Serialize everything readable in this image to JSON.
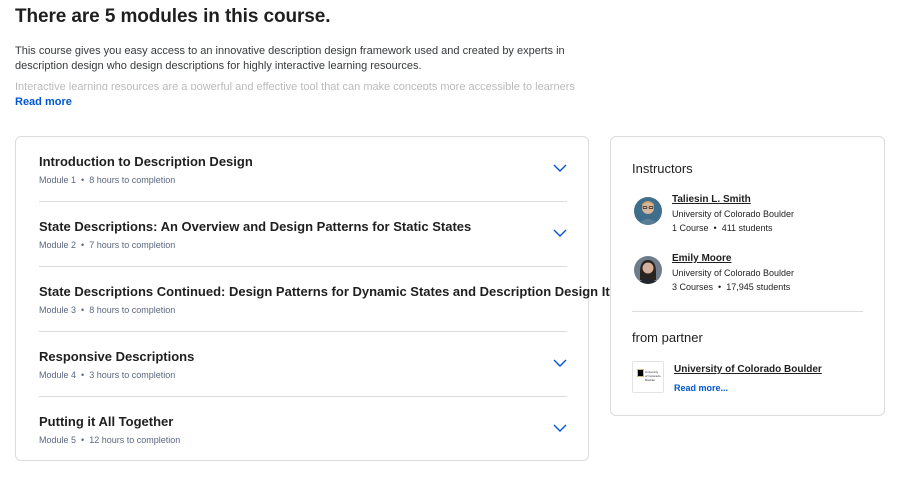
{
  "page": {
    "title": "There are 5 modules in this course.",
    "description": "This course gives you easy access to an innovative description design framework used and created by experts in description design who design descriptions for highly interactive learning resources.",
    "description_fade": "Interactive learning resources are a powerful and effective tool that can make concepts more accessible to learners everywhere.",
    "read_more": "Read more"
  },
  "modules": [
    {
      "title": "Introduction to Description Design",
      "label": "Module 1",
      "duration": "8 hours to completion",
      "expandable": true
    },
    {
      "title": "State Descriptions: An Overview and Design Patterns for Static States",
      "label": "Module 2",
      "duration": "7 hours to completion",
      "expandable": true
    },
    {
      "title": "State Descriptions Continued: Design Patterns for Dynamic States and Description Design Iteration",
      "label": "Module 3",
      "duration": "8 hours to completion",
      "expandable": false
    },
    {
      "title": "Responsive Descriptions",
      "label": "Module 4",
      "duration": "3 hours to completion",
      "expandable": true
    },
    {
      "title": "Putting it All Together",
      "label": "Module 5",
      "duration": "12 hours to completion",
      "expandable": true
    }
  ],
  "meta_separator": "•",
  "instructors": {
    "heading": "Instructors",
    "items": [
      {
        "name": "Taliesin L. Smith",
        "org": "University of Colorado Boulder",
        "courses": "1 Course",
        "students": "411 students"
      },
      {
        "name": "Emily Moore",
        "org": "University of Colorado Boulder",
        "courses": "3 Courses",
        "students": "17,945 students"
      }
    ]
  },
  "partner": {
    "heading": "from partner",
    "name": "University of Colorado Boulder",
    "read_more": "Read more...",
    "logo_text": "University of Colorado Boulder"
  },
  "colors": {
    "link_blue": "#0056d2",
    "chevron_blue": "#0056d2",
    "border": "#dadce0"
  }
}
